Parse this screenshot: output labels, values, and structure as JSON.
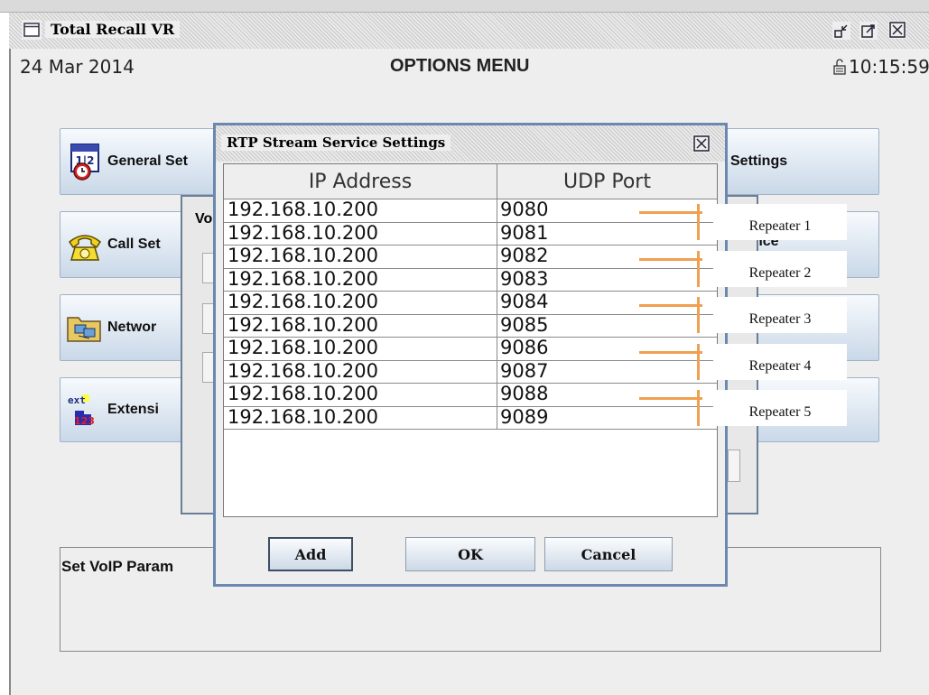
{
  "window": {
    "title": "Total Recall VR"
  },
  "header": {
    "date": "24 Mar 2014",
    "title": "OPTIONS MENU",
    "time": "10:15:59"
  },
  "menu": {
    "left": [
      {
        "label": "General Set",
        "icon": "calendar-clock-icon"
      },
      {
        "label": "Call Set",
        "icon": "telephone-icon"
      },
      {
        "label": "Networ",
        "icon": "network-folder-icon"
      },
      {
        "label": "Extensi",
        "icon": "extension-icon"
      }
    ],
    "right": [
      {
        "label": "Settings"
      },
      {
        "label": "nce"
      },
      {
        "label": ""
      },
      {
        "label": ""
      }
    ]
  },
  "sub_dialog": {
    "title_fragment": "Vo"
  },
  "status": {
    "text": "Set VoIP Param"
  },
  "rtp_dialog": {
    "title": "RTP Stream Service Settings",
    "columns": [
      "IP Address",
      "UDP Port"
    ],
    "rows": [
      {
        "ip": "192.168.10.200",
        "port": "9080"
      },
      {
        "ip": "192.168.10.200",
        "port": "9081"
      },
      {
        "ip": "192.168.10.200",
        "port": "9082"
      },
      {
        "ip": "192.168.10.200",
        "port": "9083"
      },
      {
        "ip": "192.168.10.200",
        "port": "9084"
      },
      {
        "ip": "192.168.10.200",
        "port": "9085"
      },
      {
        "ip": "192.168.10.200",
        "port": "9086"
      },
      {
        "ip": "192.168.10.200",
        "port": "9087"
      },
      {
        "ip": "192.168.10.200",
        "port": "9088"
      },
      {
        "ip": "192.168.10.200",
        "port": "9089"
      }
    ],
    "buttons": {
      "add": "Add",
      "ok": "OK",
      "cancel": "Cancel"
    }
  },
  "annotations": [
    "Repeater 1",
    "Repeater 2",
    "Repeater 3",
    "Repeater 4",
    "Repeater 5"
  ],
  "colors": {
    "annotation_line": "#f0a050",
    "dialog_border": "#6a88b0",
    "button_gradient_bottom": "#c9d8e8"
  }
}
